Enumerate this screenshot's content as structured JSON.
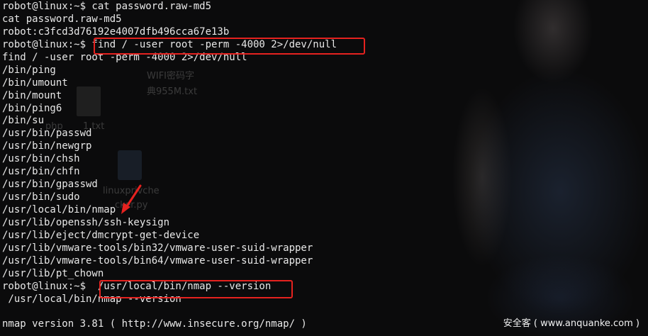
{
  "terminal": {
    "lines": [
      "robot@linux:~$ cat password.raw-md5",
      "cat password.raw-md5",
      "robot:c3fcd3d76192e4007dfb496cca67e13b",
      "robot@linux:~$ find / -user root -perm -4000 2>/dev/null",
      "find / -user root -perm -4000 2>/dev/null",
      "/bin/ping",
      "/bin/umount",
      "/bin/mount",
      "/bin/ping6",
      "/bin/su",
      "/usr/bin/passwd",
      "/usr/bin/newgrp",
      "/usr/bin/chsh",
      "/usr/bin/chfn",
      "/usr/bin/gpasswd",
      "/usr/bin/sudo",
      "/usr/local/bin/nmap",
      "/usr/lib/openssh/ssh-keysign",
      "/usr/lib/eject/dmcrypt-get-device",
      "/usr/lib/vmware-tools/bin32/vmware-user-suid-wrapper",
      "/usr/lib/vmware-tools/bin64/vmware-user-suid-wrapper",
      "/usr/lib/pt_chown",
      "robot@linux:~$  /usr/local/bin/nmap --version",
      " /usr/local/bin/nmap --version",
      "",
      "nmap version 3.81 ( http://www.insecure.org/nmap/ )"
    ]
  },
  "desktop_background": {
    "wifi_label_1": "WIFI密码字",
    "wifi_label_2": "典955M.txt",
    "php_label": "php",
    "txt_label": "1.txt",
    "py_label_1": "linuxprivche",
    "py_label_2": "cker.py"
  },
  "watermark": {
    "text": "安全客 ( www.anquanke.com )"
  },
  "colors": {
    "highlight_box": "#e5221f",
    "terminal_text": "#e8e8e8",
    "terminal_background": "#0b0b0c"
  }
}
